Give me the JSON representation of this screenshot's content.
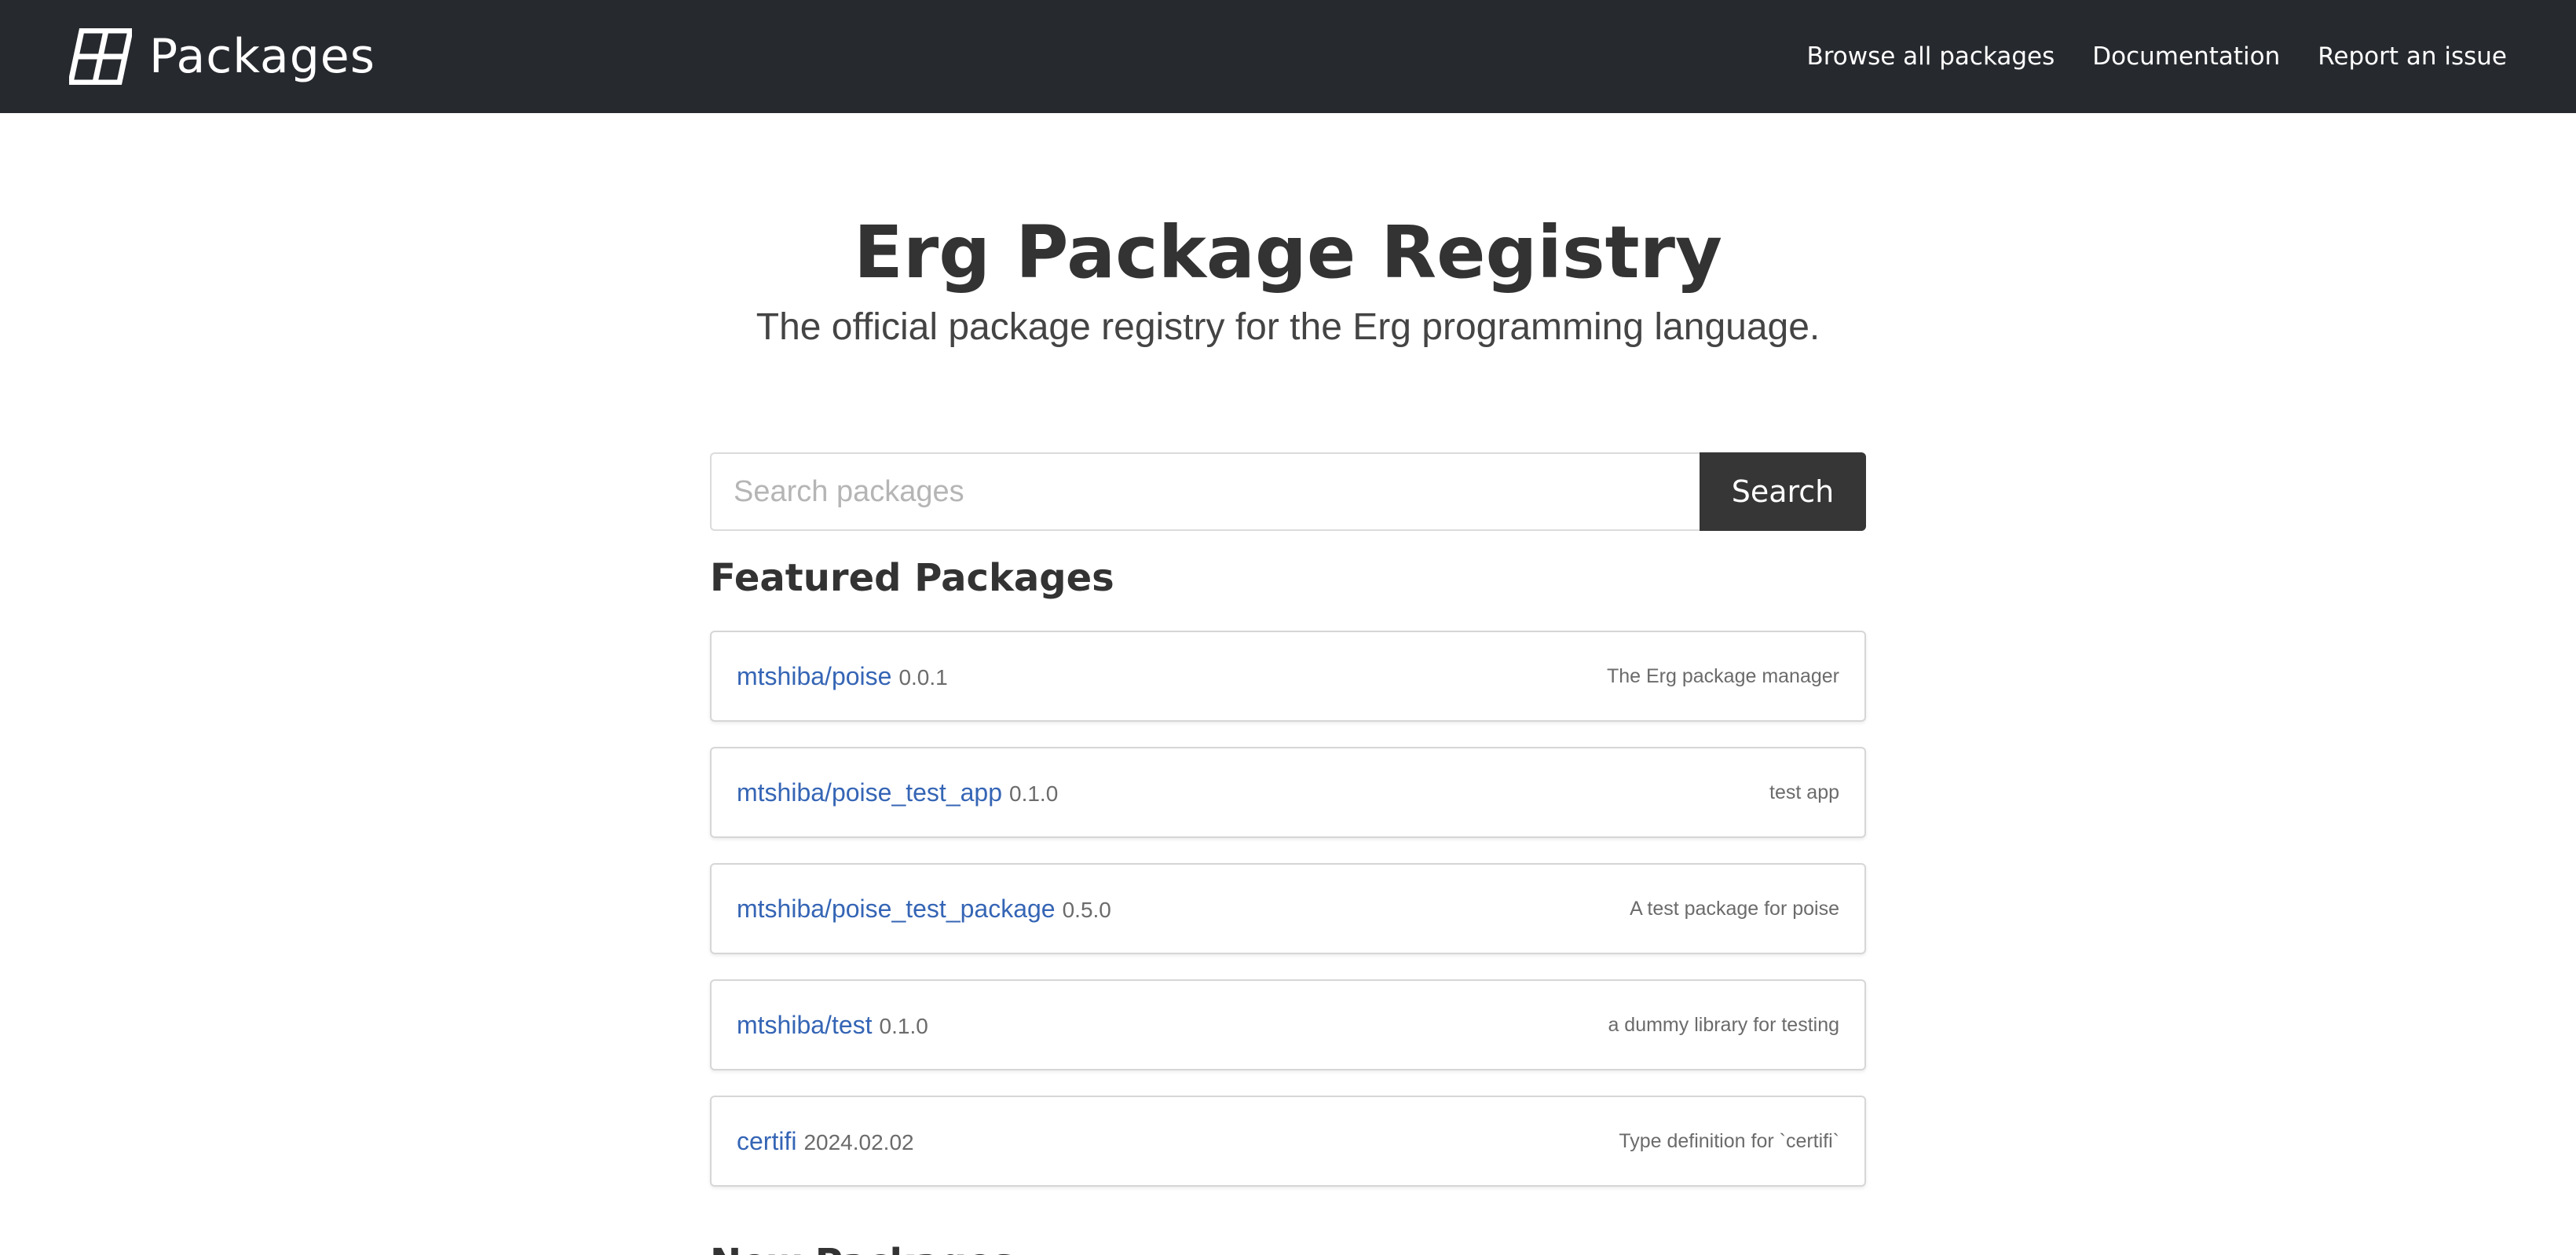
{
  "navbar": {
    "brand_text": "Packages",
    "brand_icon": "package-grid-icon",
    "links": [
      {
        "label": "Browse all packages"
      },
      {
        "label": "Documentation"
      },
      {
        "label": "Report an issue"
      }
    ]
  },
  "hero": {
    "title": "Erg Package Registry",
    "subtitle": "The official package registry for the Erg programming language."
  },
  "search": {
    "placeholder": "Search packages",
    "value": "",
    "button_label": "Search"
  },
  "featured": {
    "title": "Featured Packages",
    "packages": [
      {
        "name": "mtshiba/poise",
        "version": "0.0.1",
        "description": "The Erg package manager"
      },
      {
        "name": "mtshiba/poise_test_app",
        "version": "0.1.0",
        "description": "test app"
      },
      {
        "name": "mtshiba/poise_test_package",
        "version": "0.5.0",
        "description": "A test package for poise"
      },
      {
        "name": "mtshiba/test",
        "version": "0.1.0",
        "description": "a dummy library for testing"
      },
      {
        "name": "certifi",
        "version": "2024.02.02",
        "description": "Type definition for `certifi`"
      }
    ]
  },
  "new_packages": {
    "title": "New Packages"
  },
  "colors": {
    "navbar_bg": "#26292e",
    "link": "#3565b5",
    "button_bg": "#363636"
  }
}
